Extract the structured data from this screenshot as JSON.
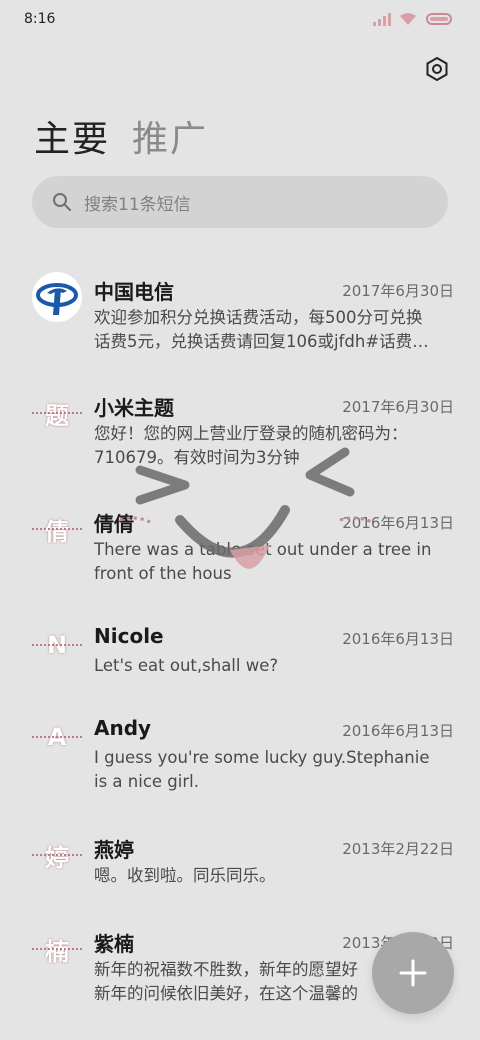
{
  "status_bar": {
    "time": "8:16",
    "icons": [
      "signal-icon",
      "wifi-icon",
      "battery-icon"
    ],
    "battery_color": "#d9a0a6"
  },
  "header": {
    "settings_icon": "hexagon-settings-icon",
    "tabs": [
      {
        "label": "主要",
        "active": true
      },
      {
        "label": "推广",
        "active": false
      }
    ]
  },
  "search": {
    "placeholder": "搜索11条短信",
    "icon": "search-icon"
  },
  "conversations": [
    {
      "name": "中国电信",
      "date": "2017年6月30日",
      "avatar": "china-telecom-logo",
      "preview": [
        "欢迎参加积分兑换话费活动，每500分可兑换",
        "话费5元，兑换话费请回复106或jfdh#话费…"
      ]
    },
    {
      "name": "小米主题",
      "date": "2017年6月30日",
      "avatar_text": "题",
      "preview": [
        "您好！您的网上营业厅登录的随机密码为：",
        "710679。有效时间为3分钟"
      ]
    },
    {
      "name": "倩倩",
      "date": "2016年6月13日",
      "avatar_text": "倩",
      "preview": [
        "There was a table set out under a tree in",
        "front of the hous"
      ]
    },
    {
      "name": "Nicole",
      "date": "2016年6月13日",
      "avatar_text": "N",
      "preview": [
        "Let's eat out,shall we?"
      ]
    },
    {
      "name": "Andy",
      "date": "2016年6月13日",
      "avatar_text": "A",
      "preview": [
        "I guess you're some lucky guy.Stephanie",
        "is a nice girl."
      ]
    },
    {
      "name": "燕婷",
      "date": "2013年2月22日",
      "avatar_text": "婷",
      "preview": [
        "嗯。收到啦。同乐同乐。"
      ]
    },
    {
      "name": "紫楠",
      "date": "2013年2月22日",
      "avatar_text": "楠",
      "preview": [
        "新年的祝福数不胜数，新年的愿望好",
        "新年的问候依旧美好，在这个温馨的"
      ]
    }
  ],
  "fab": {
    "icon": "plus-icon",
    "color": "#a8a8a8"
  },
  "colors": {
    "background": "#e4e4e4",
    "search_bg": "#d3d3d3",
    "accent_pink": "#d9a0a6"
  }
}
